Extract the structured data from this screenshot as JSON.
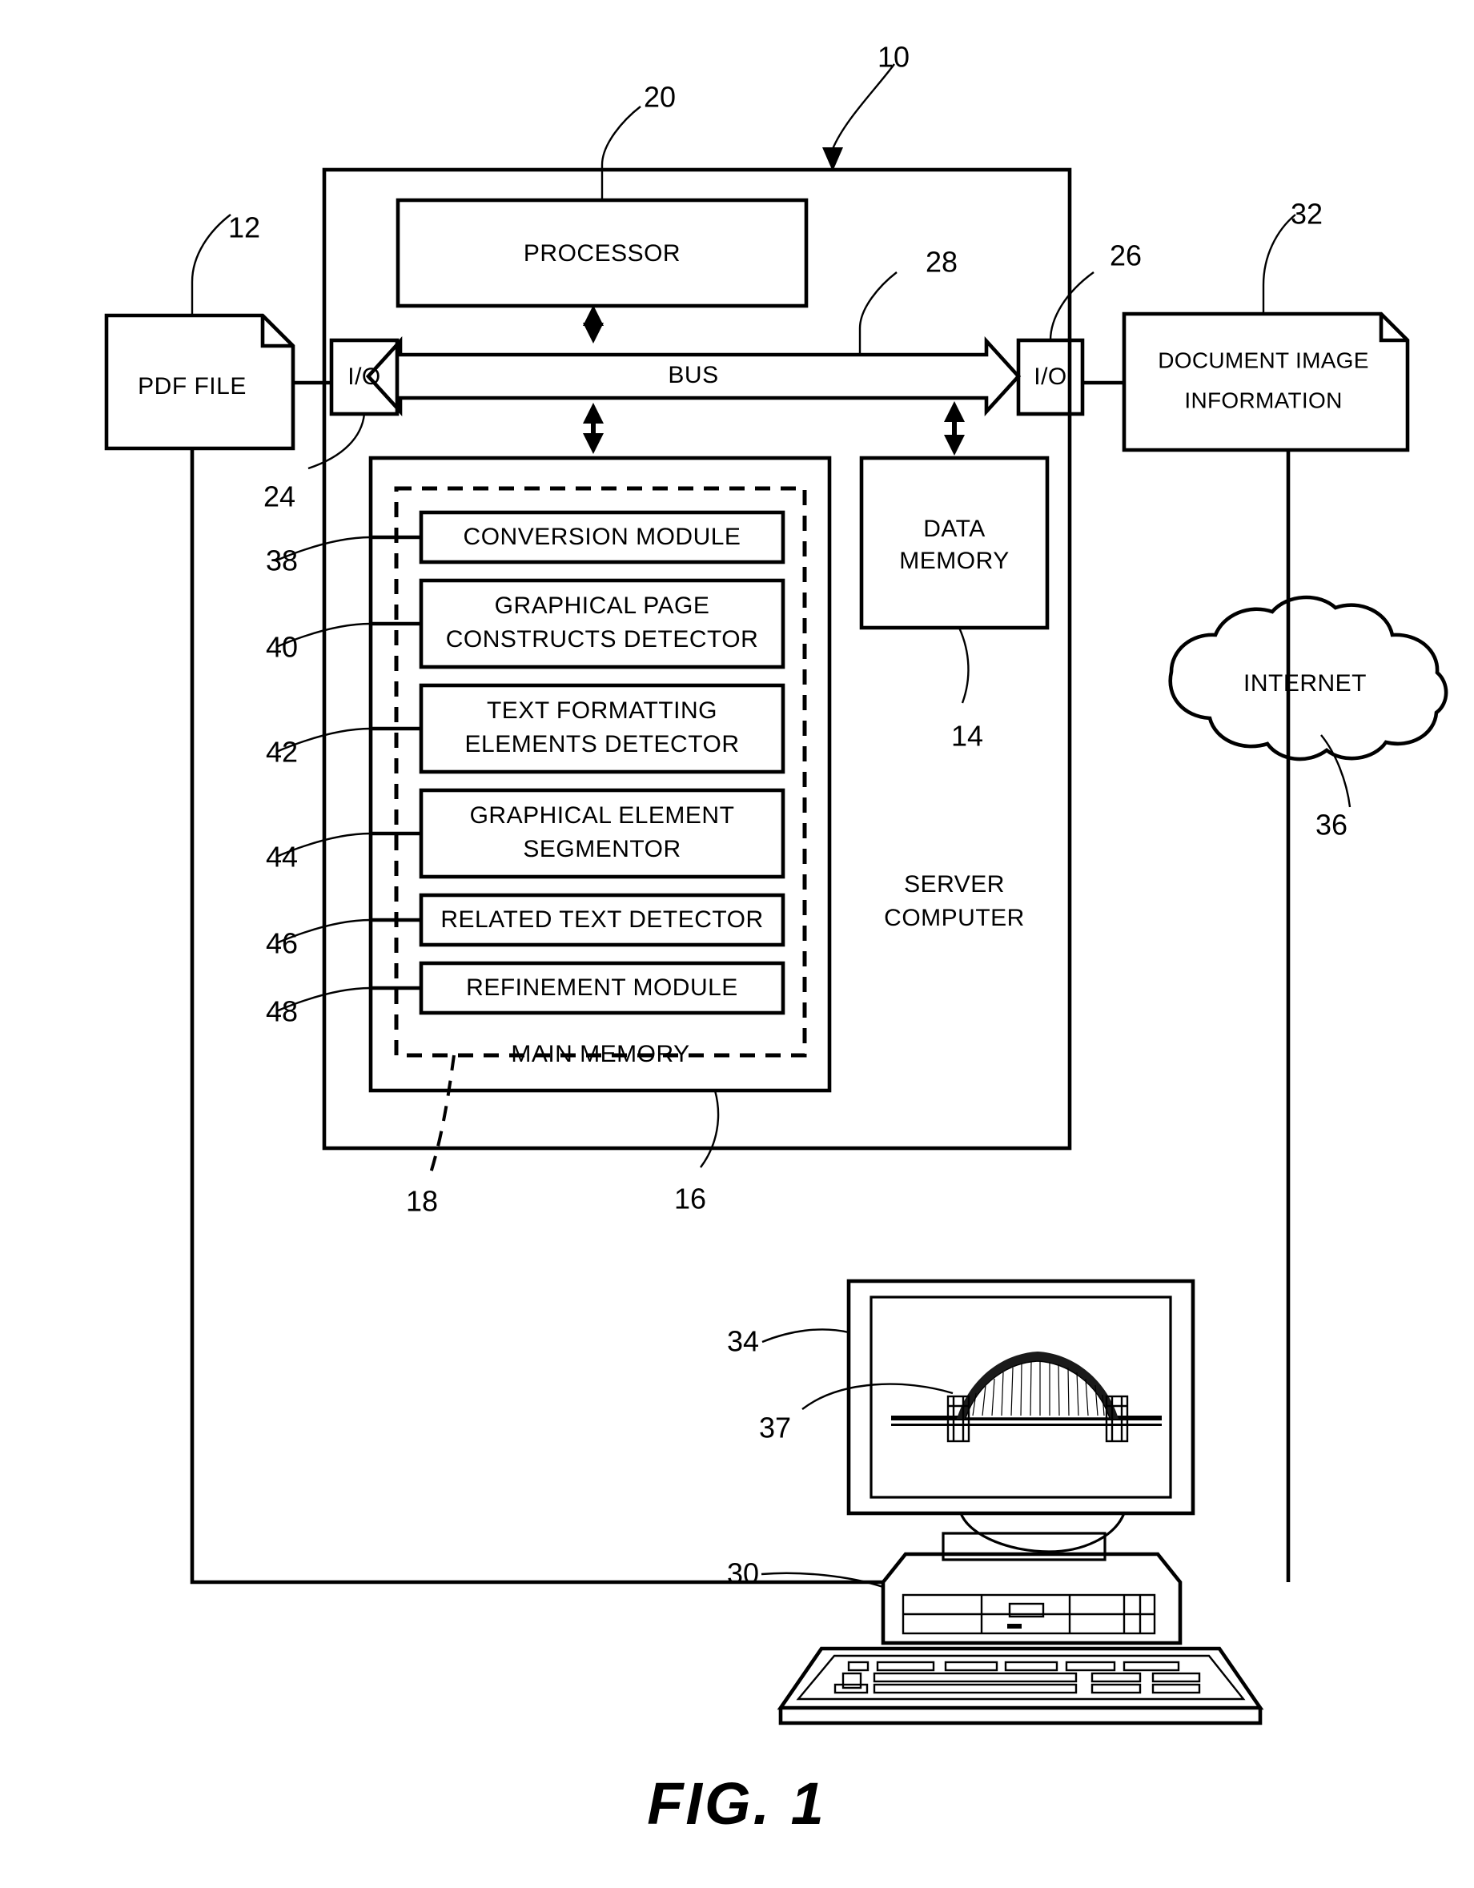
{
  "figure": {
    "caption": "FIG. 1",
    "title_ref": "10"
  },
  "nodes": {
    "pdf_file": {
      "label": "PDF FILE",
      "ref": "12"
    },
    "processor": {
      "label": "PROCESSOR",
      "ref": "20"
    },
    "bus": {
      "label": "BUS",
      "ref": "28"
    },
    "io_left": {
      "label": "I/O",
      "ref": "24"
    },
    "io_right": {
      "label": "I/O",
      "ref": "26"
    },
    "document_image_information": {
      "line1": "DOCUMENT  IMAGE",
      "line2": "INFORMATION",
      "ref": "32"
    },
    "internet": {
      "label": "INTERNET",
      "ref": "36"
    },
    "data_memory": {
      "line1": "DATA",
      "line2": "MEMORY",
      "ref": "14"
    },
    "server_computer": {
      "line1": "SERVER",
      "line2": "COMPUTER"
    },
    "main_memory": {
      "label": "MAIN MEMORY",
      "ref": "16",
      "inner_dashed_ref": "18"
    },
    "client_computer": {
      "ref": "30"
    },
    "display_screen": {
      "ref": "34"
    },
    "displayed_image": {
      "ref": "37",
      "description": "bridge-image"
    }
  },
  "main_memory_modules": [
    {
      "label": "CONVERSION MODULE",
      "ref": "38",
      "lines": [
        "CONVERSION MODULE"
      ]
    },
    {
      "label": "GRAPHICAL PAGE CONSTRUCTS DETECTOR",
      "ref": "40",
      "lines": [
        "GRAPHICAL PAGE",
        "CONSTRUCTS DETECTOR"
      ]
    },
    {
      "label": "TEXT FORMATTING ELEMENTS DETECTOR",
      "ref": "42",
      "lines": [
        "TEXT FORMATTING",
        "ELEMENTS DETECTOR"
      ]
    },
    {
      "label": "GRAPHICAL ELEMENT SEGMENTOR",
      "ref": "44",
      "lines": [
        "GRAPHICAL ELEMENT",
        "SEGMENTOR"
      ]
    },
    {
      "label": "RELATED TEXT DETECTOR",
      "ref": "46",
      "lines": [
        "RELATED TEXT DETECTOR"
      ]
    },
    {
      "label": "REFINEMENT MODULE",
      "ref": "48",
      "lines": [
        "REFINEMENT MODULE"
      ]
    }
  ],
  "reference_numerals": [
    "10",
    "12",
    "14",
    "16",
    "18",
    "20",
    "24",
    "26",
    "28",
    "30",
    "32",
    "34",
    "36",
    "37",
    "38",
    "40",
    "42",
    "44",
    "46",
    "48"
  ],
  "colors": {
    "ink": "#000000",
    "paper": "#ffffff"
  }
}
